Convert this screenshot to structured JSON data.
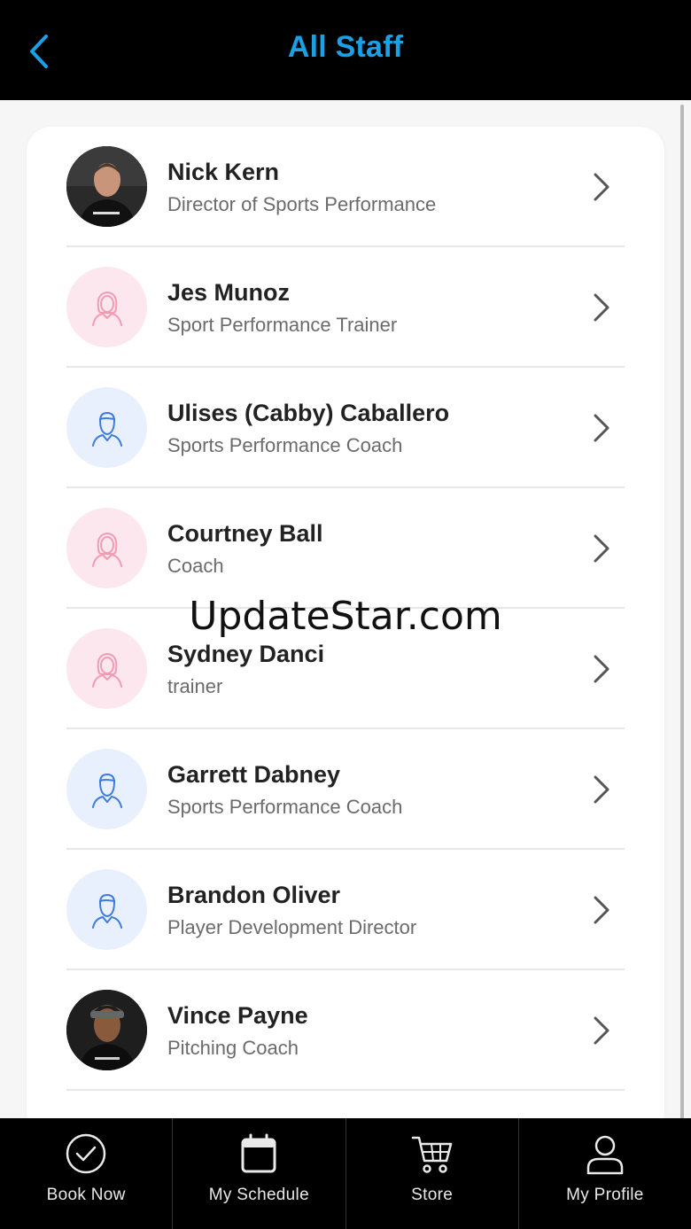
{
  "header": {
    "title": "All Staff",
    "back_icon": "chevron-left-icon"
  },
  "colors": {
    "accent": "#1aa0e6",
    "bar": "#000000",
    "female_bg": "#fde7ee",
    "female_icon": "#f29bb4",
    "male_bg": "#e9f0fd",
    "male_icon": "#3d7be0"
  },
  "staff": [
    {
      "name": "Nick Kern",
      "role": "Director of Sports Performance",
      "avatar": "photo"
    },
    {
      "name": "Jes Munoz",
      "role": "Sport Performance Trainer",
      "avatar": "female"
    },
    {
      "name": "Ulises (Cabby) Caballero",
      "role": "Sports Performance Coach",
      "avatar": "male"
    },
    {
      "name": "Courtney Ball",
      "role": "Coach",
      "avatar": "female"
    },
    {
      "name": "Sydney Danci",
      "role": "trainer",
      "avatar": "female"
    },
    {
      "name": "Garrett Dabney",
      "role": "Sports Performance Coach",
      "avatar": "male"
    },
    {
      "name": "Brandon Oliver",
      "role": "Player Development Director",
      "avatar": "male"
    },
    {
      "name": "Vince Payne",
      "role": "Pitching Coach",
      "avatar": "photo"
    }
  ],
  "watermark": "UpdateStar.com",
  "nav": [
    {
      "label": "Book Now",
      "icon": "check-circle-icon"
    },
    {
      "label": "My Schedule",
      "icon": "calendar-icon"
    },
    {
      "label": "Store",
      "icon": "cart-icon"
    },
    {
      "label": "My Profile",
      "icon": "user-icon"
    }
  ]
}
